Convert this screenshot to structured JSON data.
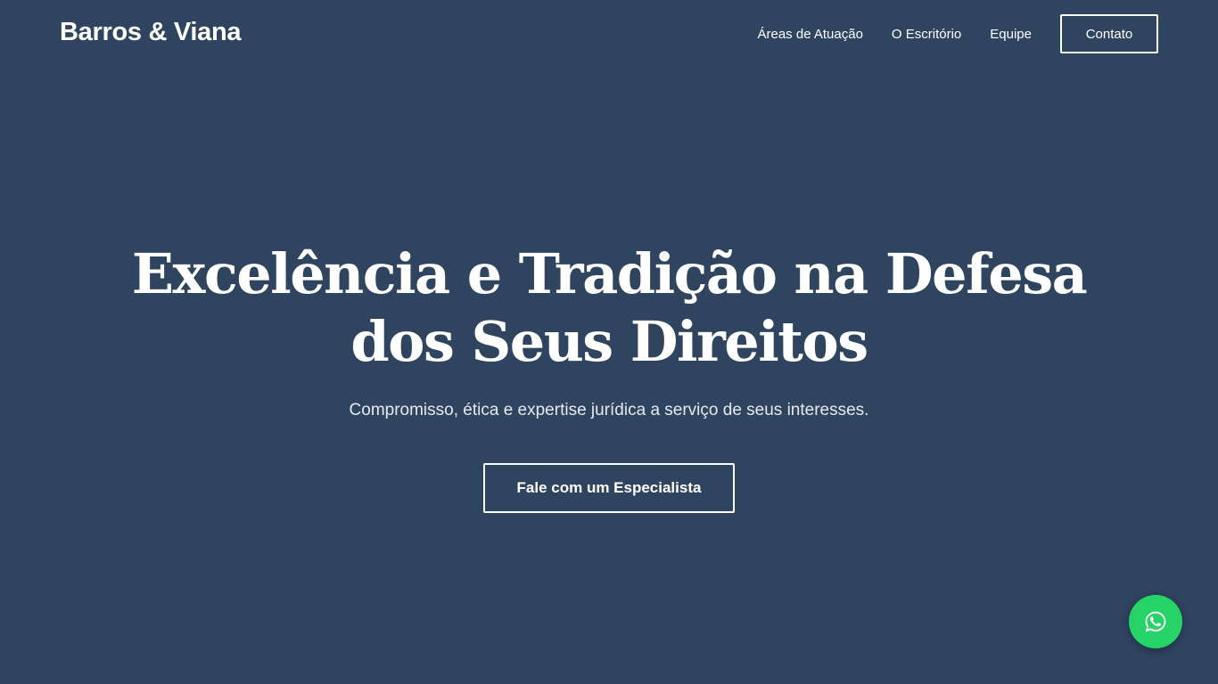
{
  "header": {
    "brand": "Barros & Viana",
    "nav": [
      {
        "label": "Áreas de Atuação"
      },
      {
        "label": "O Escritório"
      },
      {
        "label": "Equipe"
      }
    ],
    "cta_label": "Contato"
  },
  "hero": {
    "title": "Excelência e Tradição na Defesa dos Seus Direitos",
    "subtitle": "Compromisso, ética e expertise jurídica a serviço de seus interesses.",
    "cta_label": "Fale com um Especialista"
  },
  "floating": {
    "whatsapp_icon": "whatsapp-icon",
    "whatsapp_color": "#25d366"
  },
  "colors": {
    "background": "#2f445f",
    "text": "#ffffff"
  }
}
